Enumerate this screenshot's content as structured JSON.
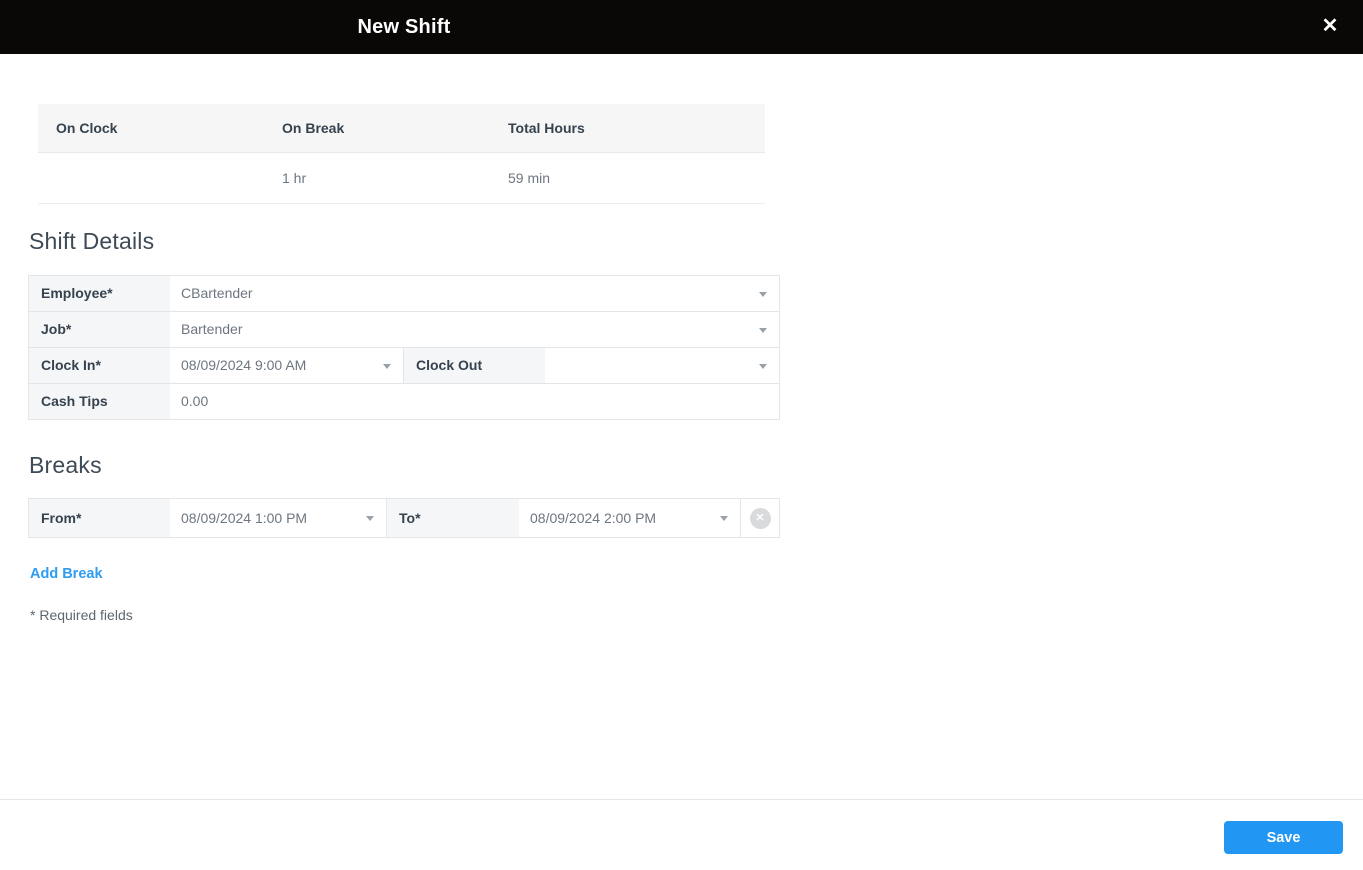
{
  "header": {
    "title": "New Shift"
  },
  "icons": {
    "close": "✕",
    "remove_break": "✕"
  },
  "summary_table": {
    "columns": [
      "On Clock",
      "On Break",
      "Total Hours"
    ],
    "row": {
      "on_clock": "",
      "on_break": "1 hr",
      "total_hours": "59 min"
    }
  },
  "shift_details": {
    "heading": "Shift Details",
    "fields": {
      "employee": {
        "label": "Employee*",
        "value": "CBartender"
      },
      "job": {
        "label": "Job*",
        "value": "Bartender"
      },
      "clock_in": {
        "label": "Clock In*",
        "value": "08/09/2024 9:00 AM"
      },
      "clock_out": {
        "label": "Clock Out",
        "value": ""
      },
      "cash_tips": {
        "label": "Cash Tips",
        "value": "0.00"
      }
    }
  },
  "breaks": {
    "heading": "Breaks",
    "rows": [
      {
        "from_label": "From*",
        "from_value": "08/09/2024 1:00 PM",
        "to_label": "To*",
        "to_value": "08/09/2024 2:00 PM"
      }
    ],
    "add_break_label": "Add Break"
  },
  "required_note": "* Required fields",
  "footer": {
    "save_label": "Save"
  },
  "colors": {
    "header_bg": "#0a0807",
    "accent_blue": "#2196f3",
    "link_blue": "#2e9cf0",
    "label_cell_bg": "#f5f6f7",
    "table_header_bg": "#f6f6f7",
    "dark_text": "#36424e",
    "muted_text": "#6d7680",
    "border": "#e3e5e7"
  }
}
